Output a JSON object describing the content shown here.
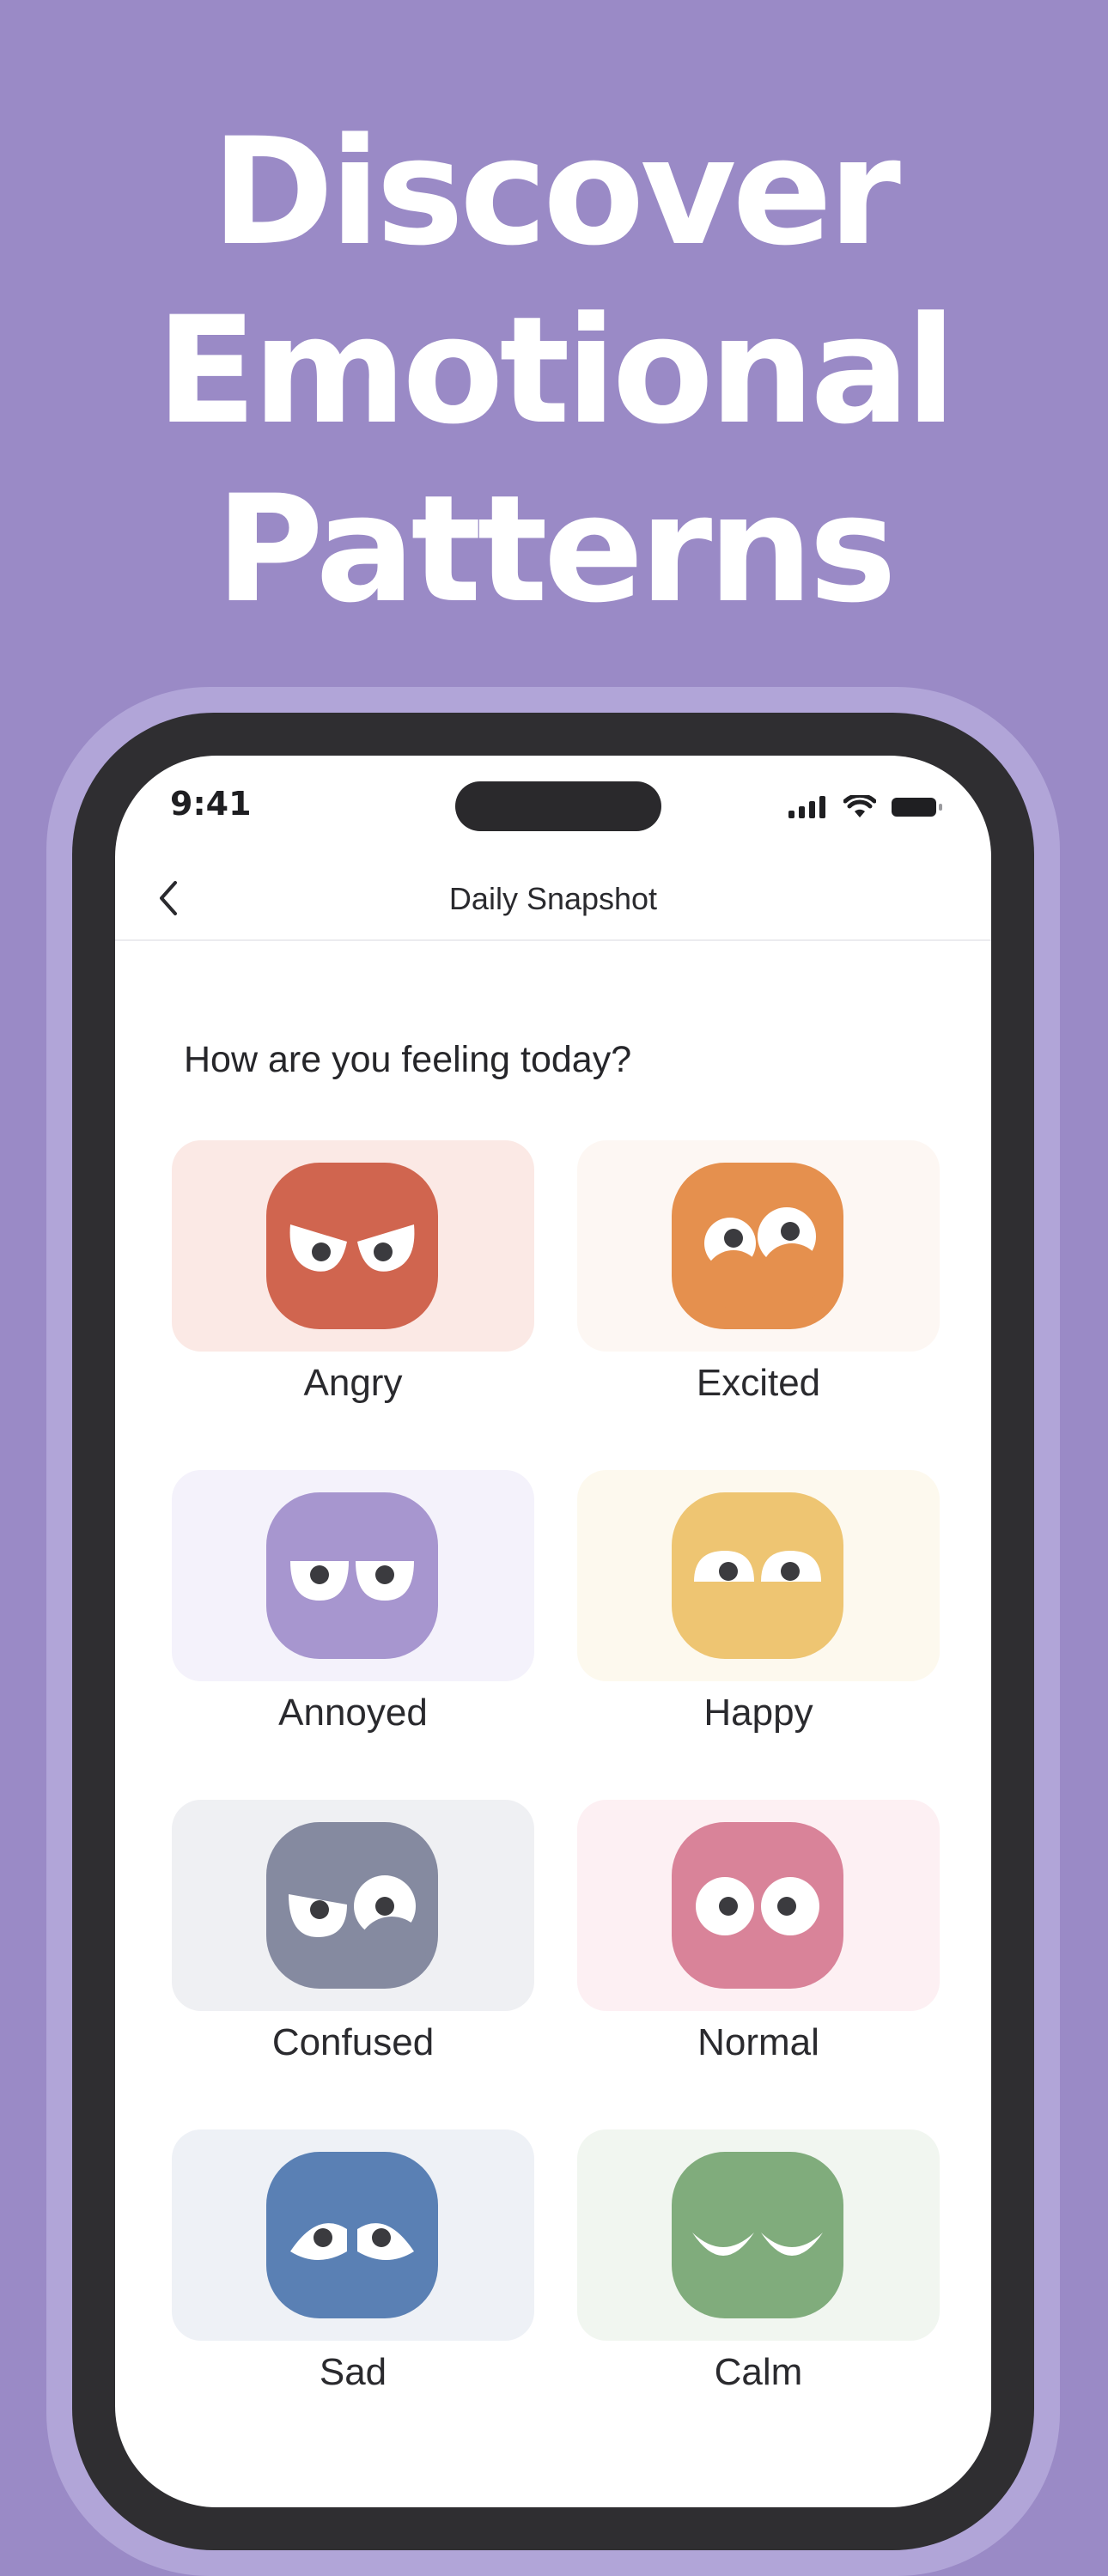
{
  "headline": {
    "line1": "Discover",
    "line2": "Emotional",
    "line3": "Patterns"
  },
  "status_bar": {
    "time": "9:41"
  },
  "nav": {
    "back_icon": "chevron-left-icon",
    "title": "Daily Snapshot"
  },
  "question": "How are you feeling today?",
  "moods": [
    {
      "label": "Angry",
      "face_color": "#d0654f",
      "card_color": "#fbe9e5"
    },
    {
      "label": "Excited",
      "face_color": "#e5904e",
      "card_color": "#fdf7f3"
    },
    {
      "label": "Annoyed",
      "face_color": "#a796cf",
      "card_color": "#f4f2fb"
    },
    {
      "label": "Happy",
      "face_color": "#eec572",
      "card_color": "#fdf9ee"
    },
    {
      "label": "Confused",
      "face_color": "#858aa0",
      "card_color": "#eff0f3"
    },
    {
      "label": "Normal",
      "face_color": "#d98399",
      "card_color": "#fdf0f3"
    },
    {
      "label": "Sad",
      "face_color": "#5a80b4",
      "card_color": "#eef1f6"
    },
    {
      "label": "Calm",
      "face_color": "#80ac7c",
      "card_color": "#f1f6f0"
    }
  ],
  "colors": {
    "background": "#9a8ac6",
    "frame": "#2f2e31",
    "halo": "#b1a5d8"
  }
}
